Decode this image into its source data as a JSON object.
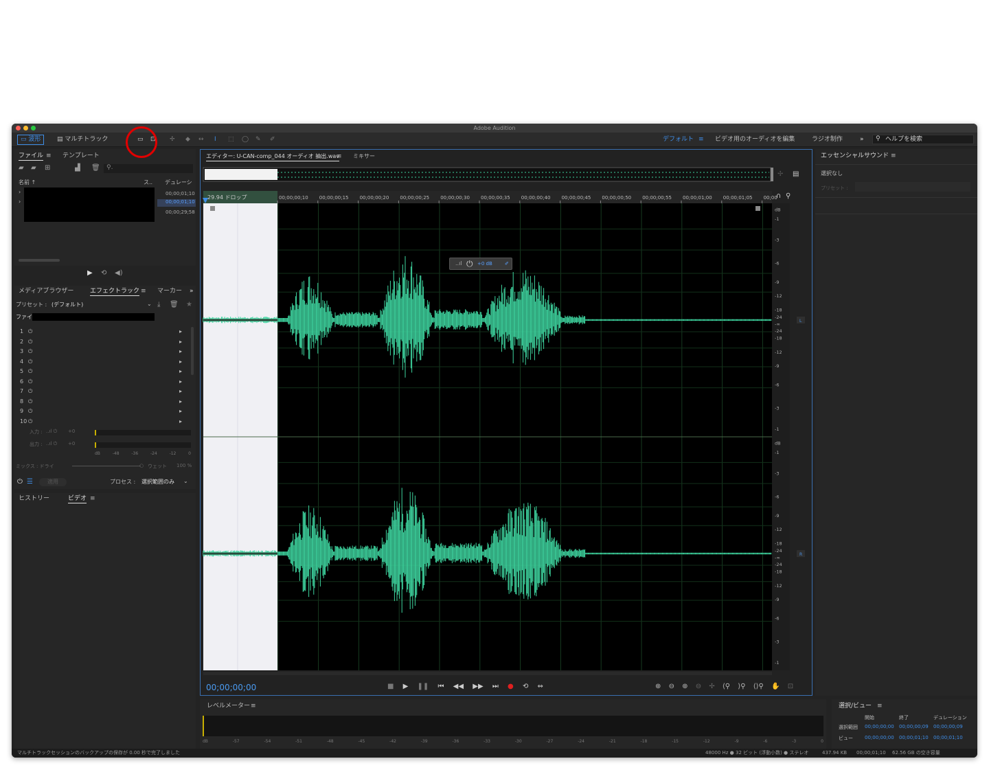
{
  "window": {
    "title": "Adobe Audition"
  },
  "toolbar": {
    "waveform_label": "波形",
    "multitrack_label": "マルチトラック",
    "workspaces": [
      "デフォルト",
      "ビデオ用のオーディオを編集",
      "ラジオ制作"
    ],
    "help_placeholder": "ヘルプを検索",
    "more_label": "»"
  },
  "files_panel": {
    "tab_files": "ファイル",
    "tab_templates": "テンプレート",
    "col_name": "名前",
    "col_sample": "ス..",
    "col_duration": "デュレーシ",
    "durations": [
      "00;00;01;10",
      "00;00;01;10",
      "00;00;29;58"
    ]
  },
  "effects_panel": {
    "tab_media_browser": "メディアブラウザー",
    "tab_effects_rack": "エフェクトラック",
    "tab_markers": "マーカー",
    "preset_label": "プリセット :",
    "preset_value": "(デフォルト)",
    "file_label": "ファイ",
    "slots": [
      "1",
      "2",
      "3",
      "4",
      "5",
      "6",
      "7",
      "8",
      "9",
      "10"
    ],
    "input_label": "入力 :",
    "output_label": "出力 :",
    "input_value": "+0",
    "output_value": "+0",
    "meter_scale": [
      "dB",
      "-48",
      "-36",
      "-24",
      "-12",
      "0"
    ],
    "mix_label": "ミックス : ドライ",
    "wet_label": "ウェット",
    "wet_value": "100 %",
    "apply_label": "適用",
    "process_label": "プロセス :",
    "process_value": "選択範囲のみ"
  },
  "history_panel": {
    "tab_history": "ヒストリー",
    "tab_video": "ビデオ"
  },
  "editor": {
    "tab_label": "エディター: U-CAN-comp_044 オーディオ 抽出.wav",
    "mixer_label": "ミキサー",
    "ruler_label": "29.94 ドロップ",
    "ruler_ticks": [
      "00;00;00;10",
      "00;00;00;15",
      "00;00;00;20",
      "00;00;00;25",
      "00;00;00;30",
      "00;00;00;35",
      "00;00;00;40",
      "00;00;00;45",
      "00;00;00;50",
      "00;00;00;55",
      "00;00;01;00",
      "00;00;01;05",
      "00;00"
    ],
    "hud_gain": "+0 dB",
    "db_scale_top": [
      "dB",
      "-1",
      "-3",
      "-6",
      "-9",
      "-12",
      "-18",
      "-24",
      "-∞",
      "-24",
      "-18",
      "-12",
      "-9",
      "-6",
      "-3",
      "-1"
    ],
    "db_scale_bottom": [
      "dB",
      "-1",
      "-3",
      "-6",
      "-9",
      "-12",
      "-18",
      "-24",
      "-∞",
      "-24",
      "-18",
      "-12",
      "-9",
      "-6",
      "-3",
      "-1"
    ],
    "channel_left": "L",
    "channel_right": "R",
    "timecode": "00;00;00;00"
  },
  "essential_sound": {
    "title": "エッセンシャルサウンド",
    "no_selection": "選択なし",
    "preset_label": "プリセット :"
  },
  "level_meter": {
    "title": "レベルメーター",
    "scale": [
      "dB",
      "-57",
      "-54",
      "-51",
      "-48",
      "-45",
      "-42",
      "-39",
      "-36",
      "-33",
      "-30",
      "-27",
      "-24",
      "-21",
      "-18",
      "-15",
      "-12",
      "-9",
      "-6",
      "-3",
      "0"
    ]
  },
  "selection_view": {
    "title": "選択/ビュー",
    "col_start": "開始",
    "col_end": "終了",
    "col_duration": "デュレーション",
    "row_selection": "選択範囲",
    "row_view": "ビュー",
    "selection": [
      "00;00;00;00",
      "00;00;00;09",
      "00;00;00;09"
    ],
    "view": [
      "00;00;00;00",
      "00;00;01;10",
      "00;00;01;10"
    ]
  },
  "status_bar": {
    "message": "マルチトラックセッションのバックアップの保存が 0.00 秒で完了しました",
    "format": "48000 Hz ● 32 ビット (浮動小数) ● ステレオ",
    "size": "437.94 KB",
    "duration": "00;00;01;10",
    "free_space": "62.56 GB の空き容量"
  },
  "colors": {
    "accent": "#3f8ee8",
    "waveform": "#3ed6a0",
    "selection": "#f0f0f4",
    "annotation": "#e00000"
  }
}
